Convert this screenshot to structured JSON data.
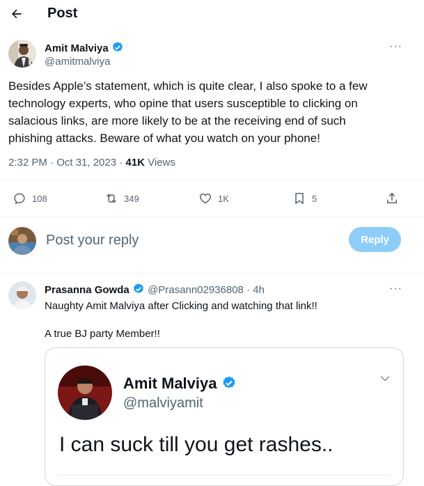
{
  "header": {
    "title": "Post"
  },
  "tweet": {
    "author_name": "Amit Malviya",
    "author_handle": "@amitmalviya",
    "text": "Besides Apple’s statement, which is quite clear, I also spoke to a few technology experts, who opine that users susceptible to clicking on salacious links, are more likely to be at the receiving end of such phishing attacks. Beware of what you watch on your phone!",
    "time": "2:32 PM · Oct 31, 2023 · ",
    "views_count": "41K",
    "views_label": " Views",
    "more": "···",
    "stats": {
      "replies": "108",
      "reposts": "349",
      "likes": "1K",
      "bookmarks": "5"
    }
  },
  "reply_box": {
    "placeholder": "Post your reply",
    "button": "Reply"
  },
  "reply": {
    "author_name": "Prasanna Gowda",
    "author_handle": "@Prasann02936808",
    "time": " · 4h",
    "more": "···",
    "line1": "Naughty Amit Malviya after Clicking and watching that link!!",
    "line2": "A true BJ party Member!!",
    "image": {
      "name": "Amit Malviya",
      "handle": "@malviyamit",
      "text": "I can suck till you get rashes.."
    }
  },
  "colors": {
    "verified": "#1d9bf0",
    "reply_button": "#8ecdf8",
    "muted": "#536471"
  }
}
